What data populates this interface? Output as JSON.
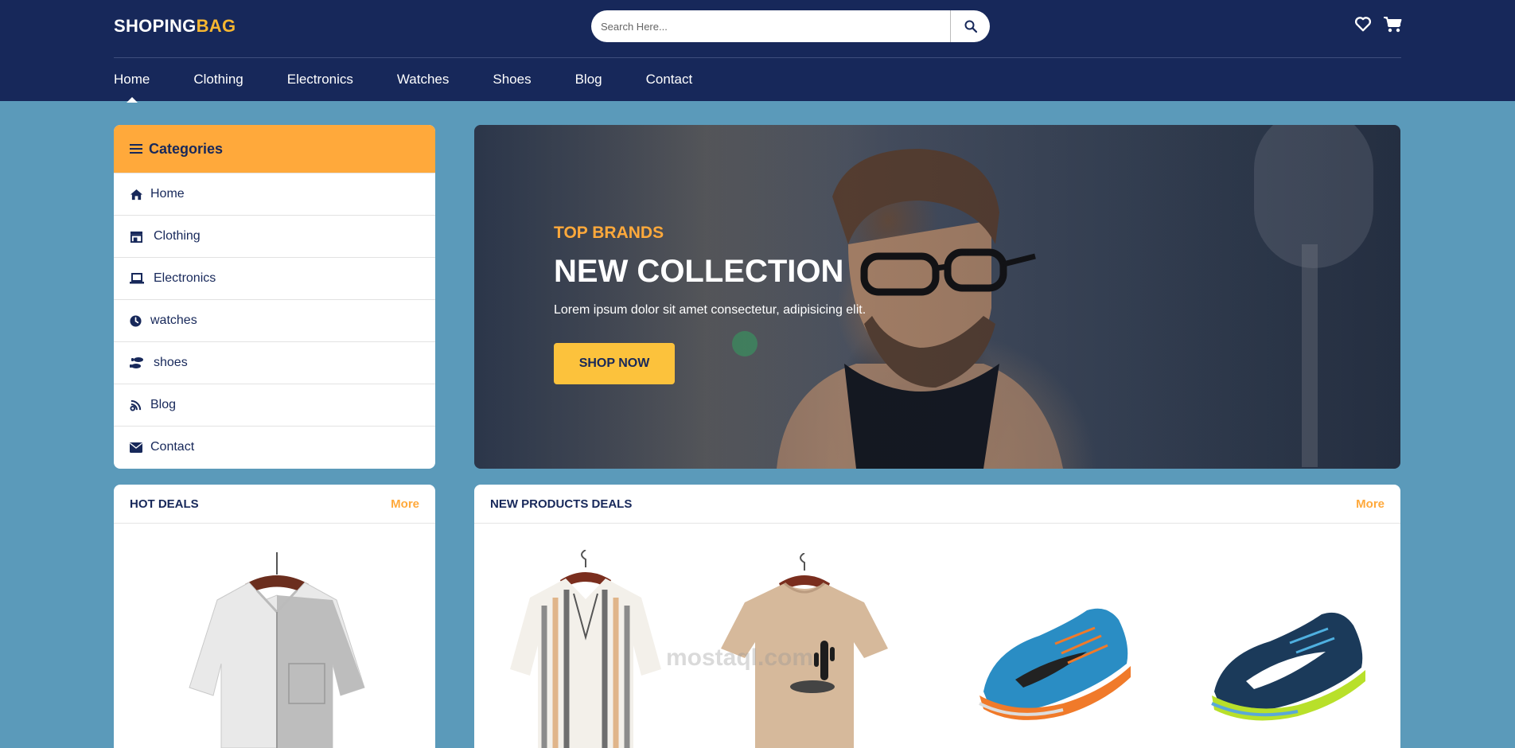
{
  "brand": {
    "part1": "SHOPING",
    "part2": "BAG"
  },
  "search": {
    "placeholder": "Search Here..."
  },
  "header_icons": [
    "heart-icon",
    "cart-icon"
  ],
  "nav": [
    {
      "label": "Home",
      "active": true
    },
    {
      "label": "Clothing"
    },
    {
      "label": "Electronics"
    },
    {
      "label": "Watches"
    },
    {
      "label": "Shoes"
    },
    {
      "label": "Blog"
    },
    {
      "label": "Contact"
    }
  ],
  "categories": {
    "title": "Categories",
    "items": [
      {
        "label": "Home",
        "icon": "home-icon"
      },
      {
        "label": "Clothing",
        "icon": "store-icon"
      },
      {
        "label": "Electronics",
        "icon": "laptop-icon"
      },
      {
        "label": "watches",
        "icon": "clock-icon"
      },
      {
        "label": "shoes",
        "icon": "shoe-prints-icon"
      },
      {
        "label": "Blog",
        "icon": "blog-icon"
      },
      {
        "label": "Contact",
        "icon": "envelope-icon"
      }
    ]
  },
  "hero": {
    "kicker": "TOP BRANDS",
    "title": "NEW COLLECTION",
    "text": "Lorem ipsum dolor sit amet consectetur, adipisicing elit.",
    "cta": "SHOP NOW"
  },
  "hot_deals": {
    "title": "HOT DEALS",
    "more": "More"
  },
  "new_products": {
    "title": "NEW PRODUCTS DEALS",
    "more": "More"
  },
  "products": [
    "white-shirt",
    "striped-shirt",
    "beige-tshirt",
    "blue-sneaker",
    "navy-sneaker"
  ],
  "colors": {
    "header": "#17285a",
    "accent": "#ffa93b",
    "cta": "#fcc23c",
    "background": "#5b9aba"
  },
  "watermark": "mostaql.com"
}
